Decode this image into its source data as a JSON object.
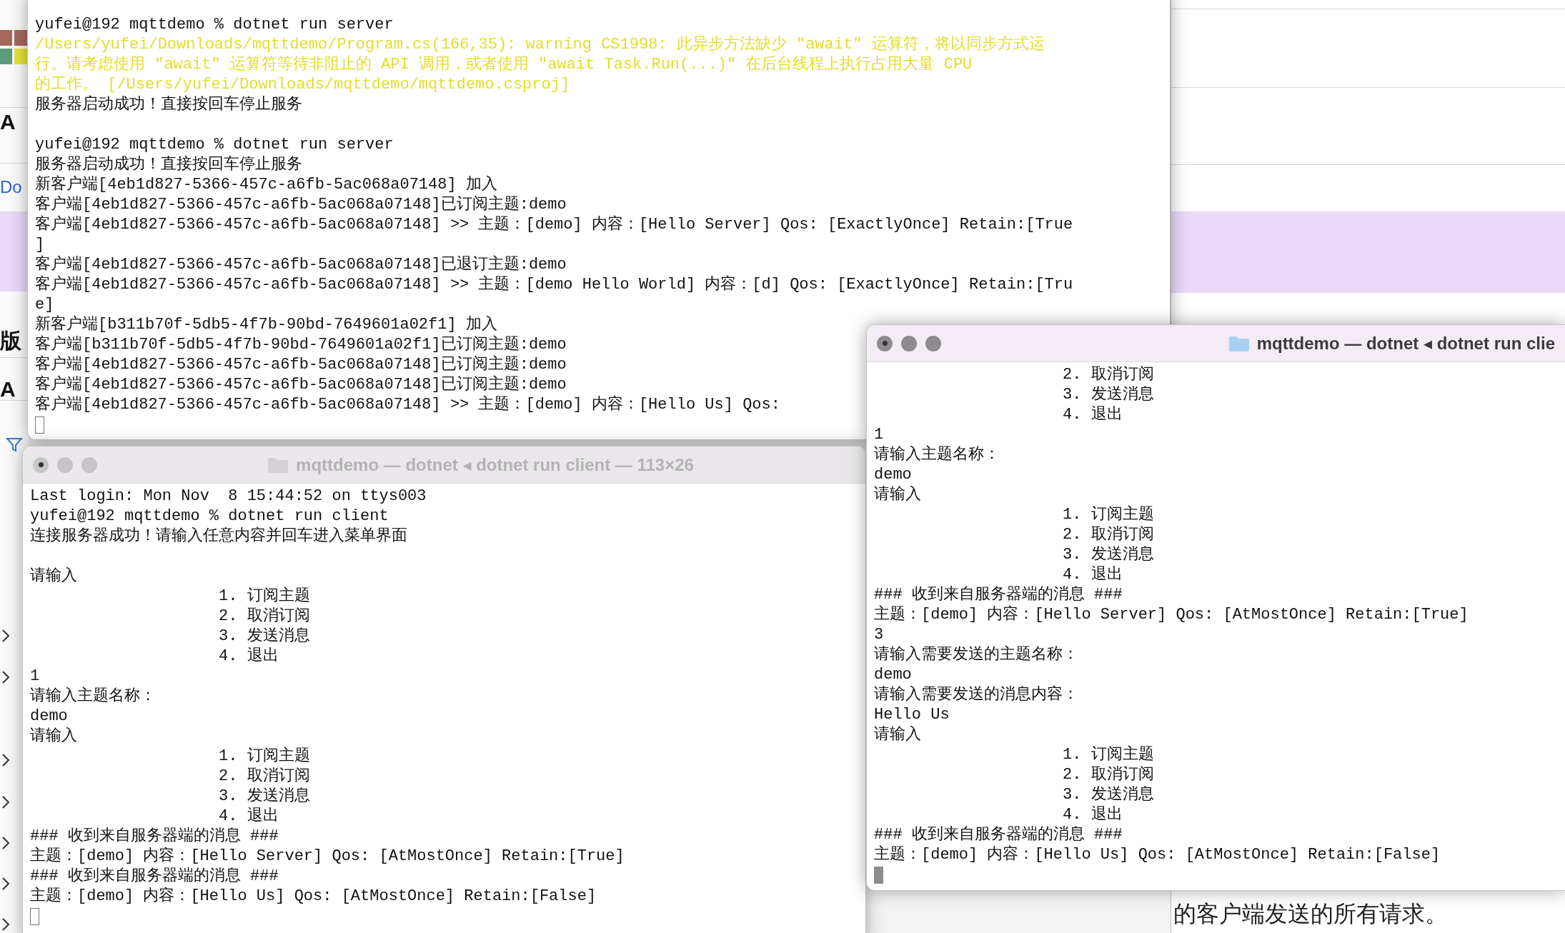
{
  "background": {
    "left_texts": [
      {
        "kind": "heading",
        "text": "A"
      },
      {
        "kind": "link",
        "text": "Do"
      },
      {
        "kind": "heading",
        "text": "版"
      },
      {
        "kind": "heading",
        "text": "A"
      }
    ],
    "bottom_text": "的客户端发送的所有请求。"
  },
  "windows": [
    {
      "active": false,
      "lines": [
        {
          "kind": "output",
          "text": "yufei@192 mqttdemo % dotnet run server"
        },
        {
          "kind": "warning",
          "text": "/Users/yufei/Downloads/mqttdemo/Program.cs(166,35): warning CS1998: 此异步方法缺少 \"await\" 运算符，将以同步方式运"
        },
        {
          "kind": "warning",
          "text": "行。请考虑使用 \"await\" 运算符等待非阻止的 API 调用，或者使用 \"await Task.Run(...)\" 在后台线程上执行占用大量 CPU"
        },
        {
          "kind": "warning",
          "text": "的工作。 [/Users/yufei/Downloads/mqttdemo/mqttdemo.csproj]"
        },
        {
          "kind": "output",
          "text": "服务器启动成功！直接按回车停止服务"
        },
        {
          "kind": "blank"
        },
        {
          "kind": "output",
          "text": "yufei@192 mqttdemo % dotnet run server"
        },
        {
          "kind": "output",
          "text": "服务器启动成功！直接按回车停止服务"
        },
        {
          "kind": "output",
          "text": "新客户端[4eb1d827-5366-457c-a6fb-5ac068a07148] 加入"
        },
        {
          "kind": "output",
          "text": "客户端[4eb1d827-5366-457c-a6fb-5ac068a07148]已订阅主题:demo"
        },
        {
          "kind": "output",
          "text": "客户端[4eb1d827-5366-457c-a6fb-5ac068a07148] >> 主题：[demo] 内容：[Hello Server] Qos: [ExactlyOnce] Retain:[True"
        },
        {
          "kind": "output",
          "text": "]"
        },
        {
          "kind": "output",
          "text": "客户端[4eb1d827-5366-457c-a6fb-5ac068a07148]已退订主题:demo"
        },
        {
          "kind": "output",
          "text": "客户端[4eb1d827-5366-457c-a6fb-5ac068a07148] >> 主题：[demo Hello World] 内容：[d] Qos: [ExactlyOnce] Retain:[Tru"
        },
        {
          "kind": "output",
          "text": "e]"
        },
        {
          "kind": "output",
          "text": "新客户端[b311b70f-5db5-4f7b-90bd-7649601a02f1] 加入"
        },
        {
          "kind": "output",
          "text": "客户端[b311b70f-5db5-4f7b-90bd-7649601a02f1]已订阅主题:demo"
        },
        {
          "kind": "output",
          "text": "客户端[4eb1d827-5366-457c-a6fb-5ac068a07148]已订阅主题:demo"
        },
        {
          "kind": "output",
          "text": "客户端[4eb1d827-5366-457c-a6fb-5ac068a07148]已订阅主题:demo"
        },
        {
          "kind": "output",
          "text": "客户端[4eb1d827-5366-457c-a6fb-5ac068a07148] >> 主题：[demo] 内容：[Hello Us] Qos:"
        },
        {
          "kind": "cursor"
        }
      ]
    },
    {
      "title": "mqttdemo — dotnet ◂ dotnet run client — 113×26",
      "active": false,
      "lines": [
        {
          "kind": "output",
          "text": "Last login: Mon Nov  8 15:44:52 on ttys003"
        },
        {
          "kind": "output",
          "text": "yufei@192 mqttdemo % dotnet run client"
        },
        {
          "kind": "output",
          "text": "连接服务器成功！请输入任意内容并回车进入菜单界面"
        },
        {
          "kind": "blank"
        },
        {
          "kind": "output",
          "text": "请输入"
        },
        {
          "kind": "output",
          "text": "                    1. 订阅主题"
        },
        {
          "kind": "output",
          "text": "                    2. 取消订阅"
        },
        {
          "kind": "output",
          "text": "                    3. 发送消息"
        },
        {
          "kind": "output",
          "text": "                    4. 退出"
        },
        {
          "kind": "output",
          "text": "1"
        },
        {
          "kind": "output",
          "text": "请输入主题名称："
        },
        {
          "kind": "output",
          "text": "demo"
        },
        {
          "kind": "output",
          "text": "请输入"
        },
        {
          "kind": "output",
          "text": "                    1. 订阅主题"
        },
        {
          "kind": "output",
          "text": "                    2. 取消订阅"
        },
        {
          "kind": "output",
          "text": "                    3. 发送消息"
        },
        {
          "kind": "output",
          "text": "                    4. 退出"
        },
        {
          "kind": "output",
          "text": "### 收到来自服务器端的消息 ###"
        },
        {
          "kind": "output",
          "text": "主题：[demo] 内容：[Hello Server] Qos: [AtMostOnce] Retain:[True]"
        },
        {
          "kind": "output",
          "text": "### 收到来自服务器端的消息 ###"
        },
        {
          "kind": "output",
          "text": "主题：[demo] 内容：[Hello Us] Qos: [AtMostOnce] Retain:[False]"
        },
        {
          "kind": "cursor"
        }
      ]
    },
    {
      "title": "mqttdemo — dotnet ◂ dotnet run clie",
      "active": true,
      "lines": [
        {
          "kind": "output",
          "text": "                    2. 取消订阅"
        },
        {
          "kind": "output",
          "text": "                    3. 发送消息"
        },
        {
          "kind": "output",
          "text": "                    4. 退出"
        },
        {
          "kind": "output",
          "text": "1"
        },
        {
          "kind": "output",
          "text": "请输入主题名称："
        },
        {
          "kind": "output",
          "text": "demo"
        },
        {
          "kind": "output",
          "text": "请输入"
        },
        {
          "kind": "output",
          "text": "                    1. 订阅主题"
        },
        {
          "kind": "output",
          "text": "                    2. 取消订阅"
        },
        {
          "kind": "output",
          "text": "                    3. 发送消息"
        },
        {
          "kind": "output",
          "text": "                    4. 退出"
        },
        {
          "kind": "output",
          "text": "### 收到来自服务器端的消息 ###"
        },
        {
          "kind": "output",
          "text": "主题：[demo] 内容：[Hello Server] Qos: [AtMostOnce] Retain:[True]"
        },
        {
          "kind": "output",
          "text": "3"
        },
        {
          "kind": "output",
          "text": "请输入需要发送的主题名称："
        },
        {
          "kind": "output",
          "text": "demo"
        },
        {
          "kind": "output",
          "text": "请输入需要发送的消息内容："
        },
        {
          "kind": "output",
          "text": "Hello Us"
        },
        {
          "kind": "output",
          "text": "请输入"
        },
        {
          "kind": "output",
          "text": "                    1. 订阅主题"
        },
        {
          "kind": "output",
          "text": "                    2. 取消订阅"
        },
        {
          "kind": "output",
          "text": "                    3. 发送消息"
        },
        {
          "kind": "output",
          "text": "                    4. 退出"
        },
        {
          "kind": "output",
          "text": "### 收到来自服务器端的消息 ###"
        },
        {
          "kind": "output",
          "text": "主题：[demo] 内容：[Hello Us] Qos: [AtMostOnce] Retain:[False]"
        },
        {
          "kind": "cursor"
        }
      ]
    }
  ]
}
